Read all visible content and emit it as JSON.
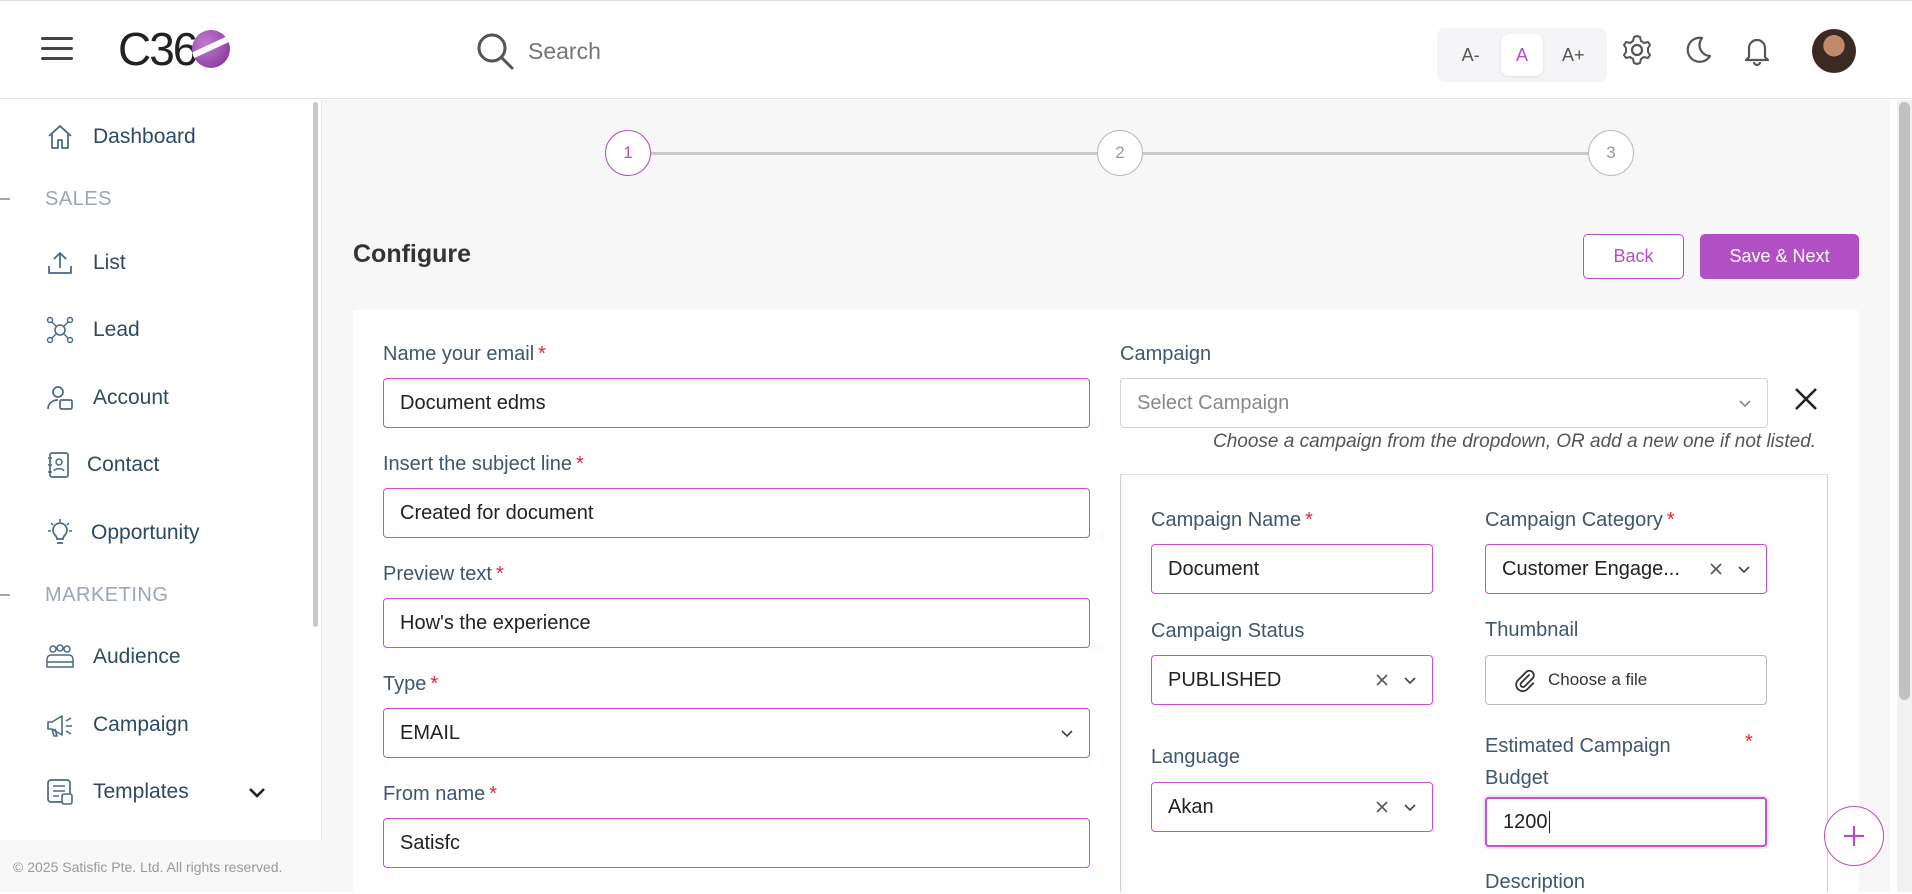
{
  "header": {
    "logo_text": "C36",
    "search_placeholder": "Search",
    "font_sizes": [
      "A-",
      "A",
      "A+"
    ],
    "active_font_size": "A"
  },
  "sidebar": {
    "items": [
      {
        "label": "Dashboard",
        "icon": "home-icon"
      },
      {
        "label": "List",
        "icon": "upload-icon"
      },
      {
        "label": "Lead",
        "icon": "network-icon"
      },
      {
        "label": "Account",
        "icon": "user-card-icon"
      },
      {
        "label": "Contact",
        "icon": "contact-book-icon"
      },
      {
        "label": "Opportunity",
        "icon": "lightbulb-icon"
      },
      {
        "label": "Audience",
        "icon": "group-icon"
      },
      {
        "label": "Campaign",
        "icon": "megaphone-icon"
      },
      {
        "label": "Templates",
        "icon": "template-icon"
      }
    ],
    "sections": {
      "sales": "SALES",
      "marketing": "MARKETING"
    },
    "footer": "© 2025 Satisfic Pte. Ltd. All rights reserved."
  },
  "stepper": {
    "steps": [
      "1",
      "2",
      "3"
    ],
    "active": 1
  },
  "page": {
    "title": "Configure",
    "back_label": "Back",
    "next_label": "Save & Next"
  },
  "form": {
    "email_name": {
      "label": "Name your email",
      "value": "Document edms"
    },
    "subject": {
      "label": "Insert the subject line",
      "value": "Created for document"
    },
    "preview": {
      "label": "Preview text",
      "value": "How's the experience"
    },
    "type": {
      "label": "Type",
      "value": "EMAIL"
    },
    "from_name": {
      "label": "From name",
      "value": "Satisfc"
    },
    "campaign": {
      "label": "Campaign",
      "placeholder": "Select Campaign",
      "hint": "Choose a campaign from the dropdown, OR add a new one if not listed."
    },
    "campaign_name": {
      "label": "Campaign Name",
      "value": "Document"
    },
    "campaign_category": {
      "label": "Campaign Category",
      "value": "Customer Engage..."
    },
    "campaign_status": {
      "label": "Campaign Status",
      "value": "PUBLISHED"
    },
    "thumbnail": {
      "label": "Thumbnail",
      "button": "Choose a file"
    },
    "language": {
      "label": "Language",
      "value": "Akan"
    },
    "budget": {
      "label_line1": "Estimated Campaign",
      "label_line2": "Budget",
      "value": "1200"
    },
    "description": {
      "label": "Description"
    },
    "required_mark": "*"
  },
  "colors": {
    "accent": "#b34fc4",
    "required": "#e0263a",
    "label": "#3e566e"
  }
}
